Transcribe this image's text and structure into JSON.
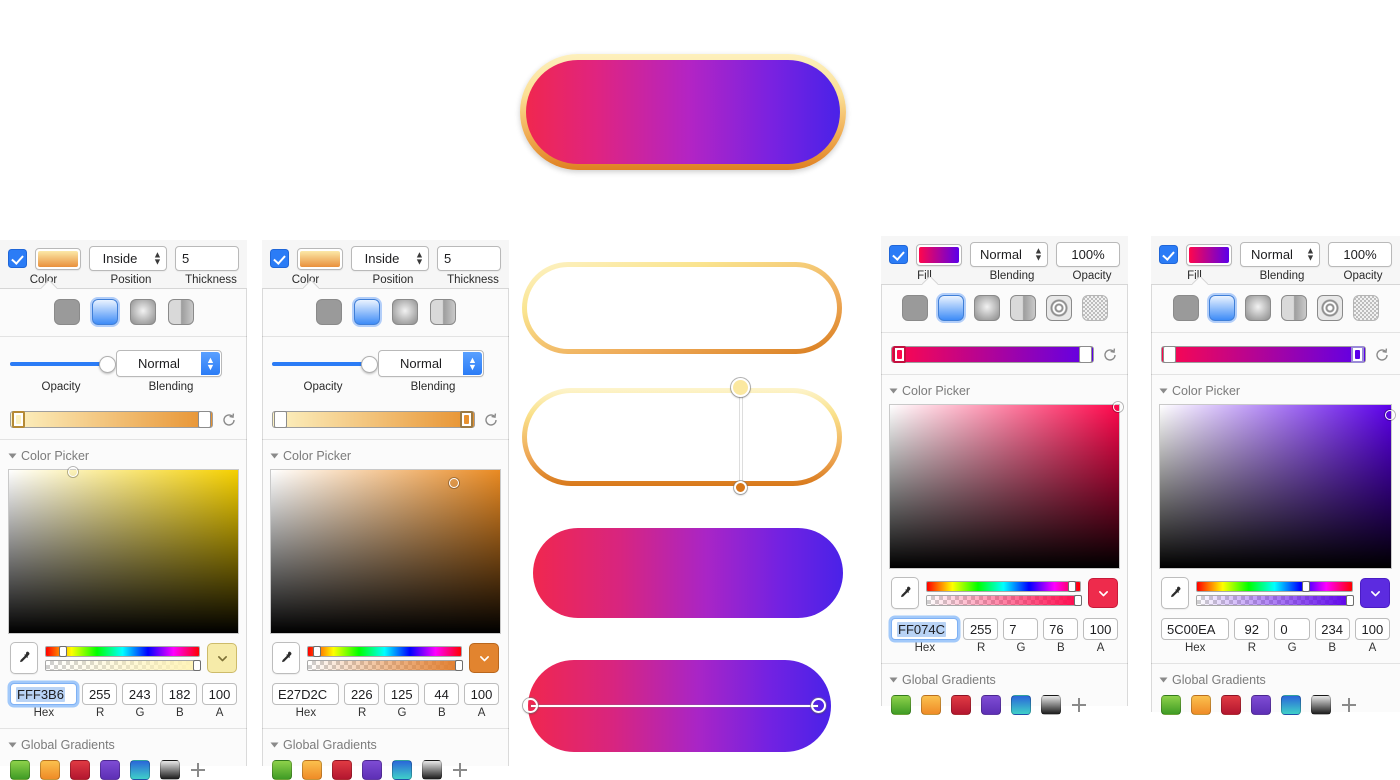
{
  "canvas": {
    "hero_shape": {
      "name": "hero-pill",
      "fill_gradient": [
        "#FF074C",
        "#5C00EA"
      ],
      "stroke_gradient": [
        "#FFF3B6",
        "#E27D2C"
      ]
    },
    "preview_shapes": [
      {
        "name": "outlined-pill-1",
        "type": "stroke-only"
      },
      {
        "name": "outlined-pill-2",
        "type": "stroke-only-with-gradient-handles"
      },
      {
        "name": "filled-pill-1",
        "type": "fill-only"
      },
      {
        "name": "filled-pill-2",
        "type": "fill-only-with-gradient-handles"
      }
    ]
  },
  "panels": [
    {
      "id": "stroke-panel-a",
      "header": {
        "checkbox_checked": true,
        "swatch_gradient": [
          "#FFF3B6",
          "#E27D2C"
        ],
        "position_value": "Inside",
        "thickness_value": "5",
        "labels": {
          "color": "Color",
          "position": "Position",
          "thickness": "Thickness"
        }
      },
      "fill_styles": [
        "solid",
        "linear-gradient",
        "radial-gradient",
        "angular-gradient"
      ],
      "fill_style_selected": 1,
      "opacity": {
        "label": "Opacity",
        "percent": 100
      },
      "blending": {
        "label": "Blending",
        "value": "Normal"
      },
      "gradient_bar": {
        "stops": [
          {
            "position": 0,
            "color": "#FFF3B6",
            "selected": true
          },
          {
            "position": 100,
            "color": "#E27D2C",
            "selected": false
          }
        ],
        "reset_icon": "reset-icon"
      },
      "color_picker": {
        "title": "Color Picker",
        "sv_marker": {
          "x_pct": 28,
          "y_pct": 1
        },
        "hue_pct": 11,
        "alpha_pct": 100,
        "eyedropper_icon": "eyedropper-icon",
        "chevron_icon": "chevron-down-icon",
        "chevron_color": "#F3E7A6",
        "hex": "FFF3B6",
        "hex_focused": true,
        "r": "255",
        "g": "243",
        "b": "182",
        "a": "100",
        "labels": {
          "hex": "Hex",
          "r": "R",
          "g": "G",
          "b": "B",
          "a": "A"
        }
      },
      "global_gradients": {
        "title": "Global Gradients",
        "swatches": [
          "green",
          "orange",
          "red",
          "purple",
          "blue-cyan",
          "black-white"
        ],
        "add_icon": "plus-icon"
      }
    },
    {
      "id": "stroke-panel-b",
      "header": {
        "checkbox_checked": true,
        "swatch_gradient": [
          "#FFF3B6",
          "#E27D2C"
        ],
        "position_value": "Inside",
        "thickness_value": "5",
        "labels": {
          "color": "Color",
          "position": "Position",
          "thickness": "Thickness"
        }
      },
      "fill_styles": [
        "solid",
        "linear-gradient",
        "radial-gradient",
        "angular-gradient"
      ],
      "fill_style_selected": 1,
      "opacity": {
        "label": "Opacity",
        "percent": 100
      },
      "blending": {
        "label": "Blending",
        "value": "Normal"
      },
      "gradient_bar": {
        "stops": [
          {
            "position": 0,
            "color": "#FFF3B6",
            "selected": false
          },
          {
            "position": 100,
            "color": "#E27D2C",
            "selected": true
          }
        ],
        "reset_icon": "reset-icon"
      },
      "color_picker": {
        "title": "Color Picker",
        "sv_marker": {
          "x_pct": 80,
          "y_pct": 8
        },
        "hue_pct": 6,
        "alpha_pct": 100,
        "eyedropper_icon": "eyedropper-icon",
        "chevron_icon": "chevron-down-icon",
        "chevron_color": "#E27D2C",
        "hex": "E27D2C",
        "hex_focused": false,
        "r": "226",
        "g": "125",
        "b": "44",
        "a": "100",
        "labels": {
          "hex": "Hex",
          "r": "R",
          "g": "G",
          "b": "B",
          "a": "A"
        }
      },
      "global_gradients": {
        "title": "Global Gradients",
        "swatches": [
          "green",
          "orange",
          "red",
          "purple",
          "blue-cyan",
          "black-white"
        ],
        "add_icon": "plus-icon"
      }
    },
    {
      "id": "fill-panel-a",
      "header": {
        "checkbox_checked": true,
        "swatch_gradient": [
          "#FF074C",
          "#5C00EA"
        ],
        "blending_value": "Normal",
        "opacity_value": "100%",
        "labels": {
          "fill": "Fill",
          "blending": "Blending",
          "opacity": "Opacity"
        }
      },
      "fill_styles": [
        "solid",
        "linear-gradient",
        "radial-gradient",
        "angular-gradient",
        "noise",
        "pattern"
      ],
      "fill_style_selected": 1,
      "gradient_bar": {
        "stops": [
          {
            "position": 0,
            "color": "#FF074C",
            "selected": true
          },
          {
            "position": 100,
            "color": "#5C00EA",
            "selected": false
          }
        ],
        "reset_icon": "reset-icon"
      },
      "color_picker": {
        "title": "Color Picker",
        "sv_marker": {
          "x_pct": 99,
          "y_pct": 1
        },
        "hue_pct": 95,
        "alpha_pct": 100,
        "eyedropper_icon": "eyedropper-icon",
        "chevron_icon": "chevron-down-icon",
        "chevron_color": "#EE2B4C",
        "hex": "FF074C",
        "hex_focused": true,
        "r": "255",
        "g": "7",
        "b": "76",
        "a": "100",
        "labels": {
          "hex": "Hex",
          "r": "R",
          "g": "G",
          "b": "B",
          "a": "A"
        }
      },
      "global_gradients": {
        "title": "Global Gradients",
        "swatches": [
          "green",
          "orange",
          "red",
          "purple",
          "blue-cyan",
          "black-white"
        ],
        "add_icon": "plus-icon"
      }
    },
    {
      "id": "fill-panel-b",
      "header": {
        "checkbox_checked": true,
        "swatch_gradient": [
          "#FF074C",
          "#5C00EA"
        ],
        "blending_value": "Normal",
        "opacity_value": "100%",
        "labels": {
          "fill": "Fill",
          "blending": "Blending",
          "opacity": "Opacity"
        }
      },
      "fill_styles": [
        "solid",
        "linear-gradient",
        "radial-gradient",
        "angular-gradient",
        "noise",
        "pattern"
      ],
      "fill_style_selected": 1,
      "gradient_bar": {
        "stops": [
          {
            "position": 0,
            "color": "#FF074C",
            "selected": false
          },
          {
            "position": 100,
            "color": "#5C00EA",
            "selected": true
          }
        ],
        "reset_icon": "reset-icon"
      },
      "color_picker": {
        "title": "Color Picker",
        "sv_marker": {
          "x_pct": 99,
          "y_pct": 6
        },
        "hue_pct": 70,
        "alpha_pct": 100,
        "eyedropper_icon": "eyedropper-icon",
        "chevron_icon": "chevron-down-icon",
        "chevron_color": "#5C2BE0",
        "hex": "5C00EA",
        "hex_focused": false,
        "r": "92",
        "g": "0",
        "b": "234",
        "a": "100",
        "labels": {
          "hex": "Hex",
          "r": "R",
          "g": "G",
          "b": "B",
          "a": "A"
        }
      },
      "global_gradients": {
        "title": "Global Gradients",
        "swatches": [
          "green",
          "orange",
          "red",
          "purple",
          "blue-cyan",
          "black-white"
        ],
        "add_icon": "plus-icon"
      }
    }
  ]
}
